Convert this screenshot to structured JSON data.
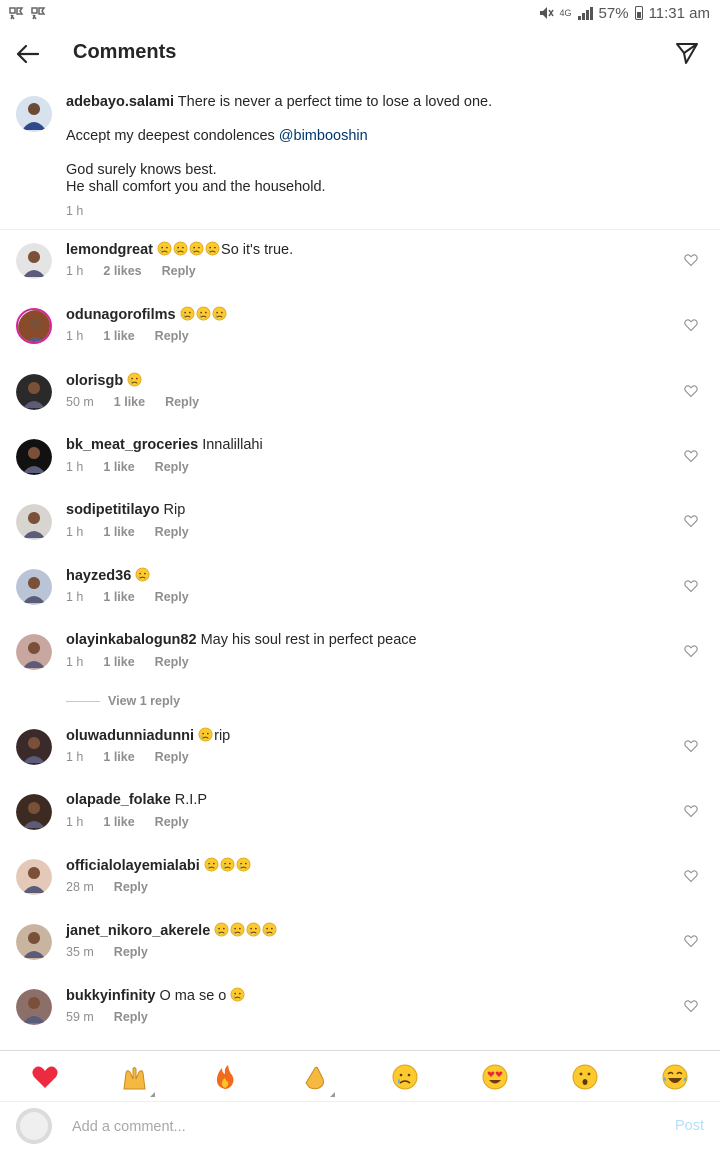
{
  "status_bar": {
    "battery": "57%",
    "time": "11:31 am",
    "network": "4G"
  },
  "header": {
    "title": "Comments"
  },
  "caption": {
    "username": "adebayo.salami",
    "line1": "There is never a perfect time to lose a loved one.",
    "line2_prefix": "Accept my deepest condolences ",
    "mention": "@bimbooshin",
    "line3": "God surely knows best.",
    "line4": "He shall comfort you and the household.",
    "time": "1 h"
  },
  "comments": [
    {
      "username": "lemondgreat",
      "emojis": 4,
      "text": "So it's true.",
      "time": "1 h",
      "likes": "2 likes",
      "reply": "Reply"
    },
    {
      "username": "odunagorofilms",
      "emojis": 3,
      "text": "",
      "time": "1 h",
      "likes": "1 like",
      "reply": "Reply"
    },
    {
      "username": "olorisgb",
      "emojis": 1,
      "text": "",
      "time": "50 m",
      "likes": "1 like",
      "reply": "Reply"
    },
    {
      "username": "bk_meat_groceries",
      "emojis": 0,
      "text": "Innalillahi",
      "time": "1 h",
      "likes": "1 like",
      "reply": "Reply"
    },
    {
      "username": "sodipetitilayo",
      "emojis": 0,
      "text": "Rip",
      "time": "1 h",
      "likes": "1 like",
      "reply": "Reply"
    },
    {
      "username": "hayzed36",
      "emojis": 1,
      "text": "",
      "time": "1 h",
      "likes": "1 like",
      "reply": "Reply"
    },
    {
      "username": "olayinkabalogun82",
      "emojis": 0,
      "text": "May his soul rest in perfect peace",
      "time": "1 h",
      "likes": "1 like",
      "reply": "Reply"
    },
    {
      "username": "oluwadunniadunni",
      "emojis": 1,
      "text": "rip",
      "time": "1 h",
      "likes": "1 like",
      "reply": "Reply"
    },
    {
      "username": "olapade_folake",
      "emojis": 0,
      "text": "R.I.P",
      "time": "1 h",
      "likes": "1 like",
      "reply": "Reply"
    },
    {
      "username": "officialolayemialabi",
      "emojis": 3,
      "text": "",
      "time": "28 m",
      "likes": "",
      "reply": "Reply"
    },
    {
      "username": "janet_nikoro_akerele",
      "emojis": 4,
      "text": "",
      "time": "35 m",
      "likes": "",
      "reply": "Reply"
    },
    {
      "username": "bukkyinfinity",
      "emojis": 0,
      "text": "O ma se o",
      "time": "59 m",
      "likes": "",
      "reply": "Reply",
      "trailing_emoji": 1
    }
  ],
  "view_replies": "View 1 reply",
  "emoji_bar": [
    "heart-emoji",
    "raised-hands-emoji",
    "fire-emoji",
    "clapping-hands-emoji",
    "crying-face-emoji",
    "heart-eyes-emoji",
    "surprised-face-emoji",
    "laughing-tears-emoji"
  ],
  "comment_input": {
    "placeholder": "Add a comment...",
    "post_label": "Post"
  },
  "colors": {
    "link": "#00376b",
    "meta": "#8e8e8e",
    "post_disabled": "#b2dffc"
  }
}
